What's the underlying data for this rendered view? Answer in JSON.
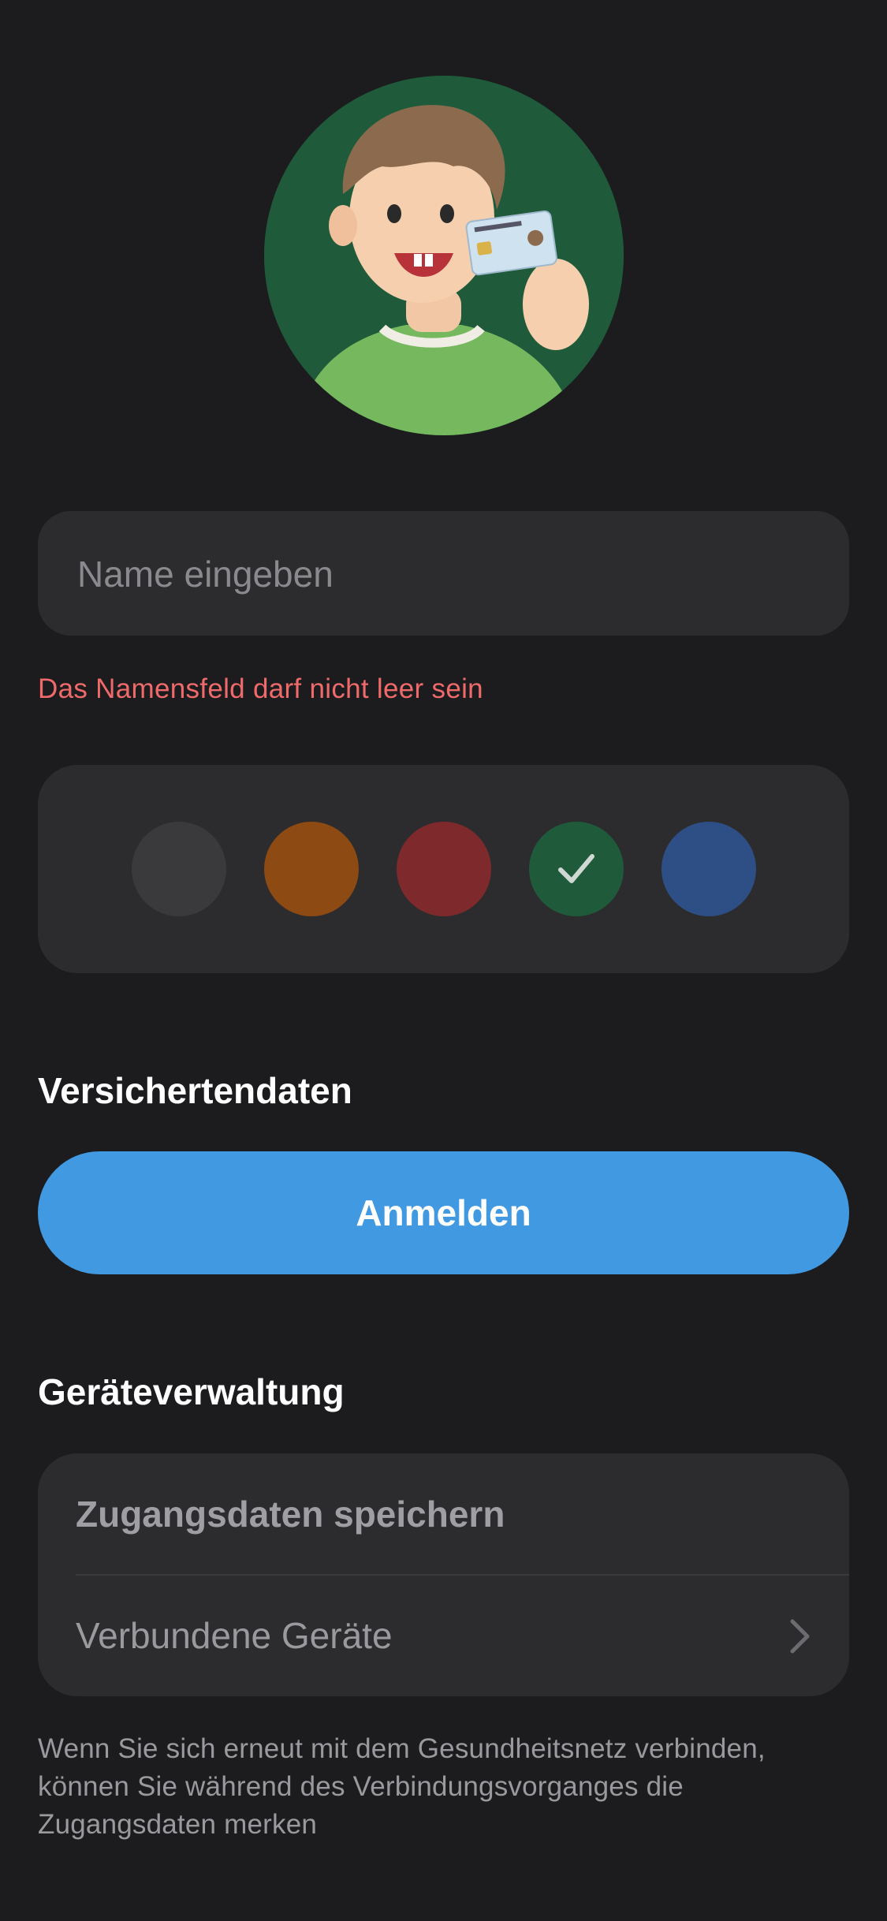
{
  "name_input": {
    "placeholder": "Name eingeben",
    "value": "",
    "error": "Das Namensfeld darf nicht leer sein"
  },
  "color_picker": {
    "swatches": [
      {
        "color": "#3a3a3c",
        "selected": false
      },
      {
        "color": "#8d4a12",
        "selected": false
      },
      {
        "color": "#7e2a2c",
        "selected": false
      },
      {
        "color": "#1f5a3b",
        "selected": true
      },
      {
        "color": "#2e4f86",
        "selected": false
      }
    ]
  },
  "insurance_section": {
    "title": "Versichertendaten",
    "button_label": "Anmelden"
  },
  "device_section": {
    "title": "Geräteverwaltung",
    "rows": [
      {
        "label": "Zugangsdaten speichern"
      },
      {
        "label": "Verbundene Geräte",
        "icon": "chevron-right-icon"
      }
    ],
    "footnote": "Wenn Sie sich erneut mit dem Gesundheitsnetz verbinden, können Sie während des Verbindungsvorganges die Zugangsdaten merken"
  },
  "colors": {
    "background": "#1c1c1e",
    "card": "#2c2c2e",
    "accent": "#4199e2",
    "error": "#ef6a6a"
  }
}
